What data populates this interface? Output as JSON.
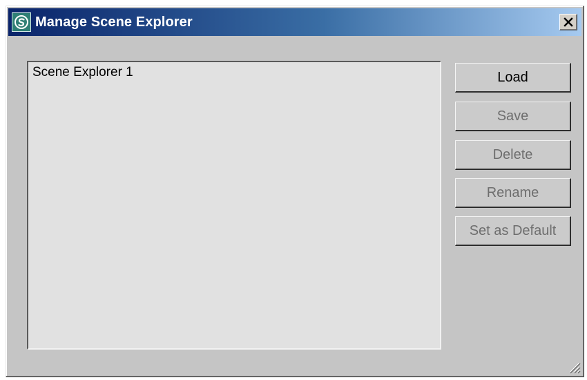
{
  "window": {
    "title": "Manage Scene Explorer",
    "close_glyph": "✕",
    "app_icon": "3ds-max-s-icon"
  },
  "explorer_list": {
    "items": [
      "Scene Explorer 1"
    ]
  },
  "buttons": {
    "load": {
      "label": "Load",
      "enabled": true
    },
    "save": {
      "label": "Save",
      "enabled": false
    },
    "delete": {
      "label": "Delete",
      "enabled": false
    },
    "rename": {
      "label": "Rename",
      "enabled": false
    },
    "set_default": {
      "label": "Set as Default",
      "enabled": false
    }
  },
  "colors": {
    "titlebar_start": "#0a246a",
    "titlebar_end": "#a6caf0",
    "dialog_bg": "#c5c5c5",
    "list_bg": "#e1e1e1",
    "disabled_text": "#6e6e6e"
  }
}
